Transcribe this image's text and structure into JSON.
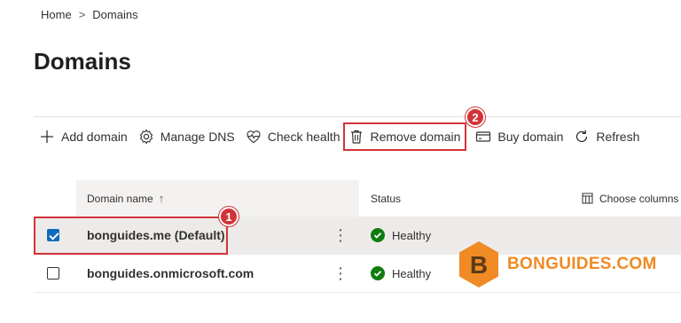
{
  "breadcrumb": {
    "home": "Home",
    "separator": ">",
    "current": "Domains"
  },
  "page_title": "Domains",
  "toolbar": {
    "add_domain": "Add domain",
    "manage_dns": "Manage DNS",
    "check_health": "Check health",
    "remove_domain": "Remove domain",
    "buy_domain": "Buy domain",
    "refresh": "Refresh"
  },
  "table": {
    "columns": {
      "domain_name": "Domain name",
      "sort_indicator": "↑",
      "status": "Status",
      "choose_columns": "Choose columns"
    },
    "rows": [
      {
        "name": "bonguides.me (Default)",
        "status": "Healthy",
        "selected": true
      },
      {
        "name": "bonguides.onmicrosoft.com",
        "status": "Healthy",
        "selected": false
      }
    ]
  },
  "annotations": {
    "step1": "1",
    "step2": "2"
  },
  "watermark": {
    "letter": "B",
    "text": "BONGUIDES.COM"
  },
  "colors": {
    "accent": "#0f6cbd",
    "highlight": "#d13438",
    "healthy": "#107c10",
    "watermark": "#f08a24"
  }
}
